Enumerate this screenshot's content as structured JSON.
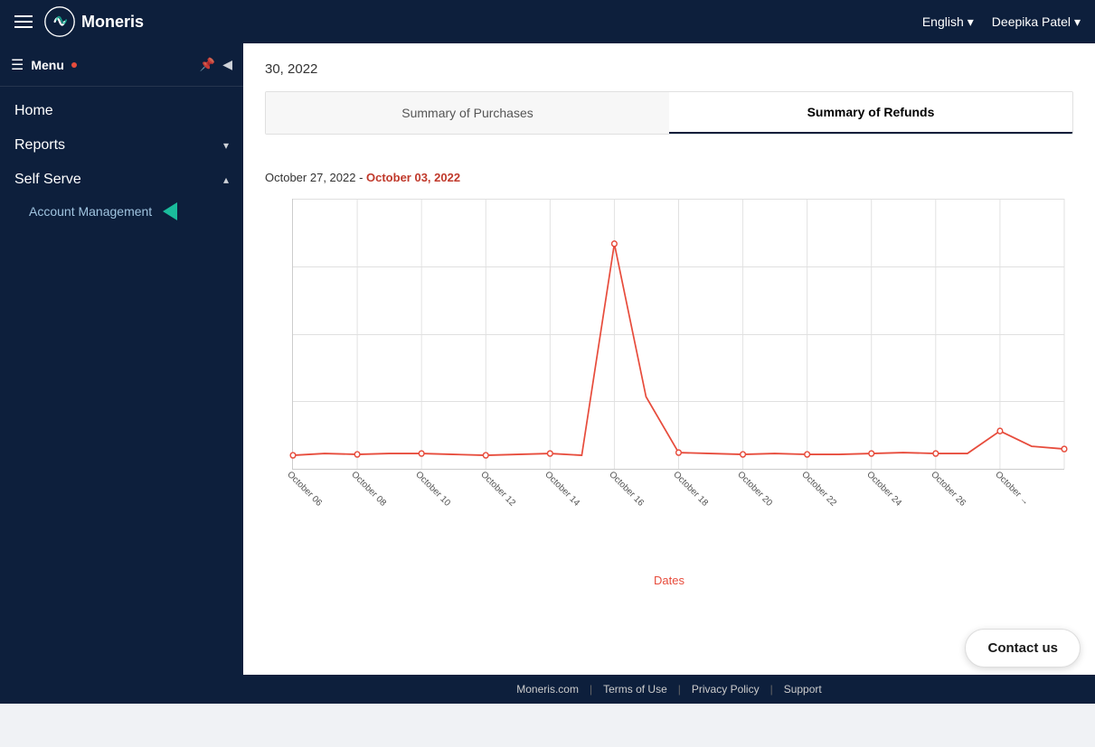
{
  "topbar": {
    "brand": "Moneris",
    "language": "English",
    "language_chevron": "▾",
    "user": "Deepika Patel",
    "user_chevron": "▾"
  },
  "sidebar": {
    "menu_label": "Menu",
    "items": [
      {
        "id": "home",
        "label": "Home",
        "has_children": false
      },
      {
        "id": "reports",
        "label": "Reports",
        "has_children": true,
        "chevron": "▾"
      },
      {
        "id": "self-serve",
        "label": "Self Serve",
        "has_children": true,
        "chevron": "▴",
        "expanded": true
      },
      {
        "id": "account-management",
        "label": "Account Management",
        "is_sub": true
      }
    ]
  },
  "main": {
    "date_header": "30, 2022",
    "tabs": [
      {
        "id": "purchases",
        "label": "Summary of Purchases",
        "active": false
      },
      {
        "id": "refunds",
        "label": "Summary of Refunds",
        "active": true
      }
    ],
    "chart": {
      "date_range_prefix": "October 27, 2022 - ",
      "date_range_suffix": "October 03, 2022",
      "x_labels": [
        "October 06",
        "October 08",
        "October 10",
        "October 12",
        "October 14",
        "October 16",
        "October 18",
        "October 20",
        "October 22",
        "October 24",
        "October 26",
        "October →"
      ],
      "x_axis_title": "Dates"
    }
  },
  "footer": {
    "links": [
      {
        "id": "moneris-com",
        "label": "Moneris.com"
      },
      {
        "id": "terms",
        "label": "Terms of Use"
      },
      {
        "id": "privacy",
        "label": "Privacy Policy"
      },
      {
        "id": "support",
        "label": "Support"
      }
    ]
  },
  "contact": {
    "label": "Contact us"
  }
}
